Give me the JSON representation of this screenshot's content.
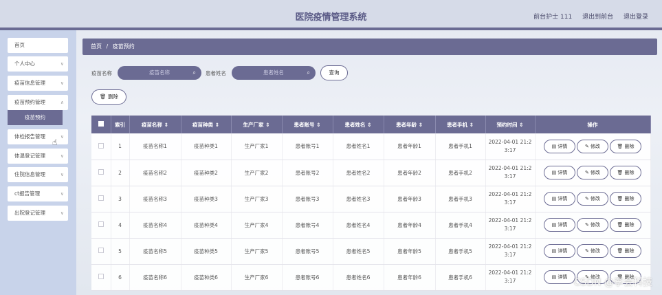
{
  "header": {
    "title": "医院疫情管理系统",
    "user": "前台护士 111",
    "to_frontend": "退出到前台",
    "logout": "退出登录"
  },
  "sidebar": {
    "items": [
      {
        "label": "首页",
        "has_chevron": false
      },
      {
        "label": "个人中心",
        "has_chevron": true
      },
      {
        "label": "疫苗信息管理",
        "has_chevron": true
      },
      {
        "label": "疫苗预约管理",
        "has_chevron": true
      },
      {
        "label": "体检报告管理",
        "has_chevron": true
      },
      {
        "label": "体温登记管理",
        "has_chevron": true
      },
      {
        "label": "住院信息管理",
        "has_chevron": true
      },
      {
        "label": "ct报告管理",
        "has_chevron": true
      },
      {
        "label": "出院登记管理",
        "has_chevron": true
      }
    ],
    "submenu_active": "疫苗预约"
  },
  "breadcrumb": {
    "home": "首页",
    "sep": "/",
    "current": "疫苗预约"
  },
  "search": {
    "vaccine_label": "疫苗名称",
    "vaccine_placeholder": "疫苗名称",
    "patient_label": "患者姓名",
    "patient_placeholder": "患者姓名",
    "button": "查询"
  },
  "actions": {
    "delete": "删除"
  },
  "table": {
    "headers": [
      "索引",
      "疫苗名称",
      "疫苗种类",
      "生产厂家",
      "患者账号",
      "患者姓名",
      "患者年龄",
      "患者手机",
      "预约时间",
      "操作"
    ],
    "op_labels": {
      "detail": "详情",
      "edit": "修改",
      "delete": "删除"
    },
    "rows": [
      {
        "index": "1",
        "vaccine_name": "疫苗名称1",
        "vaccine_type": "疫苗种类1",
        "maker": "生产厂家1",
        "account": "患者账号1",
        "name": "患者姓名1",
        "age": "患者年龄1",
        "phone": "患者手机1",
        "time_line1": "2022-04-01 21:2",
        "time_line2": "3:17"
      },
      {
        "index": "2",
        "vaccine_name": "疫苗名称2",
        "vaccine_type": "疫苗种类2",
        "maker": "生产厂家2",
        "account": "患者账号2",
        "name": "患者姓名2",
        "age": "患者年龄2",
        "phone": "患者手机2",
        "time_line1": "2022-04-01 21:2",
        "time_line2": "3:17"
      },
      {
        "index": "3",
        "vaccine_name": "疫苗名称3",
        "vaccine_type": "疫苗种类3",
        "maker": "生产厂家3",
        "account": "患者账号3",
        "name": "患者姓名3",
        "age": "患者年龄3",
        "phone": "患者手机3",
        "time_line1": "2022-04-01 21:2",
        "time_line2": "3:17"
      },
      {
        "index": "4",
        "vaccine_name": "疫苗名称4",
        "vaccine_type": "疫苗种类4",
        "maker": "生产厂家4",
        "account": "患者账号4",
        "name": "患者姓名4",
        "age": "患者年龄4",
        "phone": "患者手机4",
        "time_line1": "2022-04-01 21:2",
        "time_line2": "3:17"
      },
      {
        "index": "5",
        "vaccine_name": "疫苗名称5",
        "vaccine_type": "疫苗种类5",
        "maker": "生产厂家5",
        "account": "患者账号5",
        "name": "患者姓名5",
        "age": "患者年龄5",
        "phone": "患者手机5",
        "time_line1": "2022-04-01 21:2",
        "time_line2": "3:17"
      },
      {
        "index": "6",
        "vaccine_name": "疫苗名称6",
        "vaccine_type": "疫苗种类6",
        "maker": "生产厂家6",
        "account": "患者账号6",
        "name": "患者姓名6",
        "age": "患者年龄6",
        "phone": "患者手机6",
        "time_line1": "2022-04-01 21:2",
        "time_line2": "3:17"
      }
    ]
  },
  "watermark": "CSDN @李会科技",
  "colors": {
    "accent": "#6b6b93",
    "sidebar_bg": "#c8d3ea"
  }
}
